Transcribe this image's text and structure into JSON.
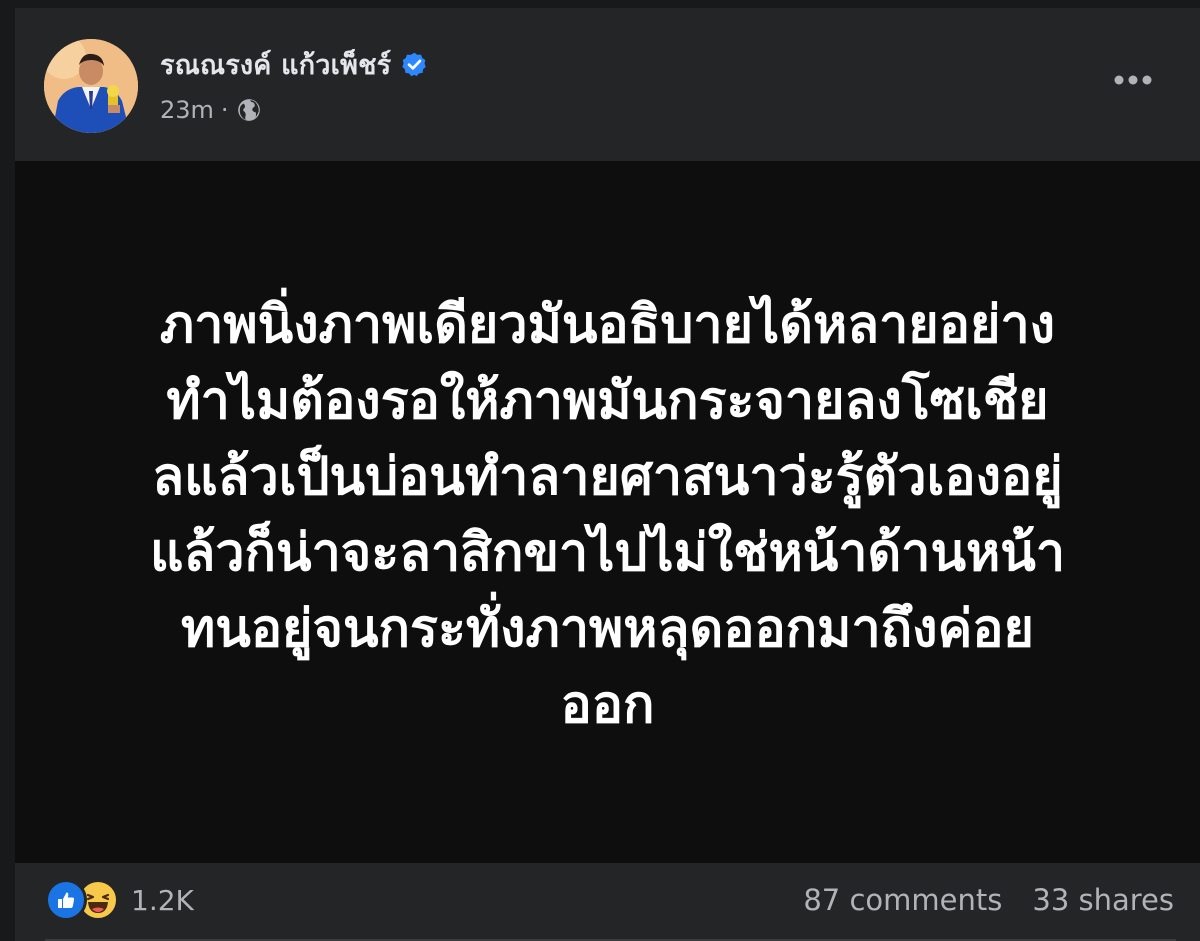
{
  "post": {
    "author_name": "รณณรงค์ แก้วเพ็ชร์",
    "verified": true,
    "timestamp": "23m",
    "separator": "·",
    "audience_icon": "globe-icon",
    "more_icon": "more-options-icon",
    "body_lines": [
      "ภาพนิ่งภาพเดียวมันอธิบายได้หลายอย่าง",
      "ทำไมต้องรอให้ภาพมันกระจายลงโซเชีย",
      "ลแล้วเป็นบ่อนทำลายศาสนาว่ะรู้ตัวเองอยู่",
      "แล้วก็น่าจะลาสิกขาไปไม่ใช่หน้าด้านหน้า",
      "ทนอยู่จนกระทั่งภาพหลุดออกมาถึงค่อย",
      "ออก"
    ],
    "background_color": "#0e0e0e"
  },
  "footer": {
    "reaction_icons": [
      "like-icon",
      "haha-icon"
    ],
    "reaction_count": "1.2K",
    "comments": "87 comments",
    "shares": "33 shares"
  },
  "colors": {
    "card": "#242526",
    "page": "#18191a",
    "verified": "#2d88ff",
    "like": "#1b74e4",
    "haha": "#f7c94b",
    "secondary_text": "#b0b3b8",
    "primary_text": "#e4e6eb"
  }
}
